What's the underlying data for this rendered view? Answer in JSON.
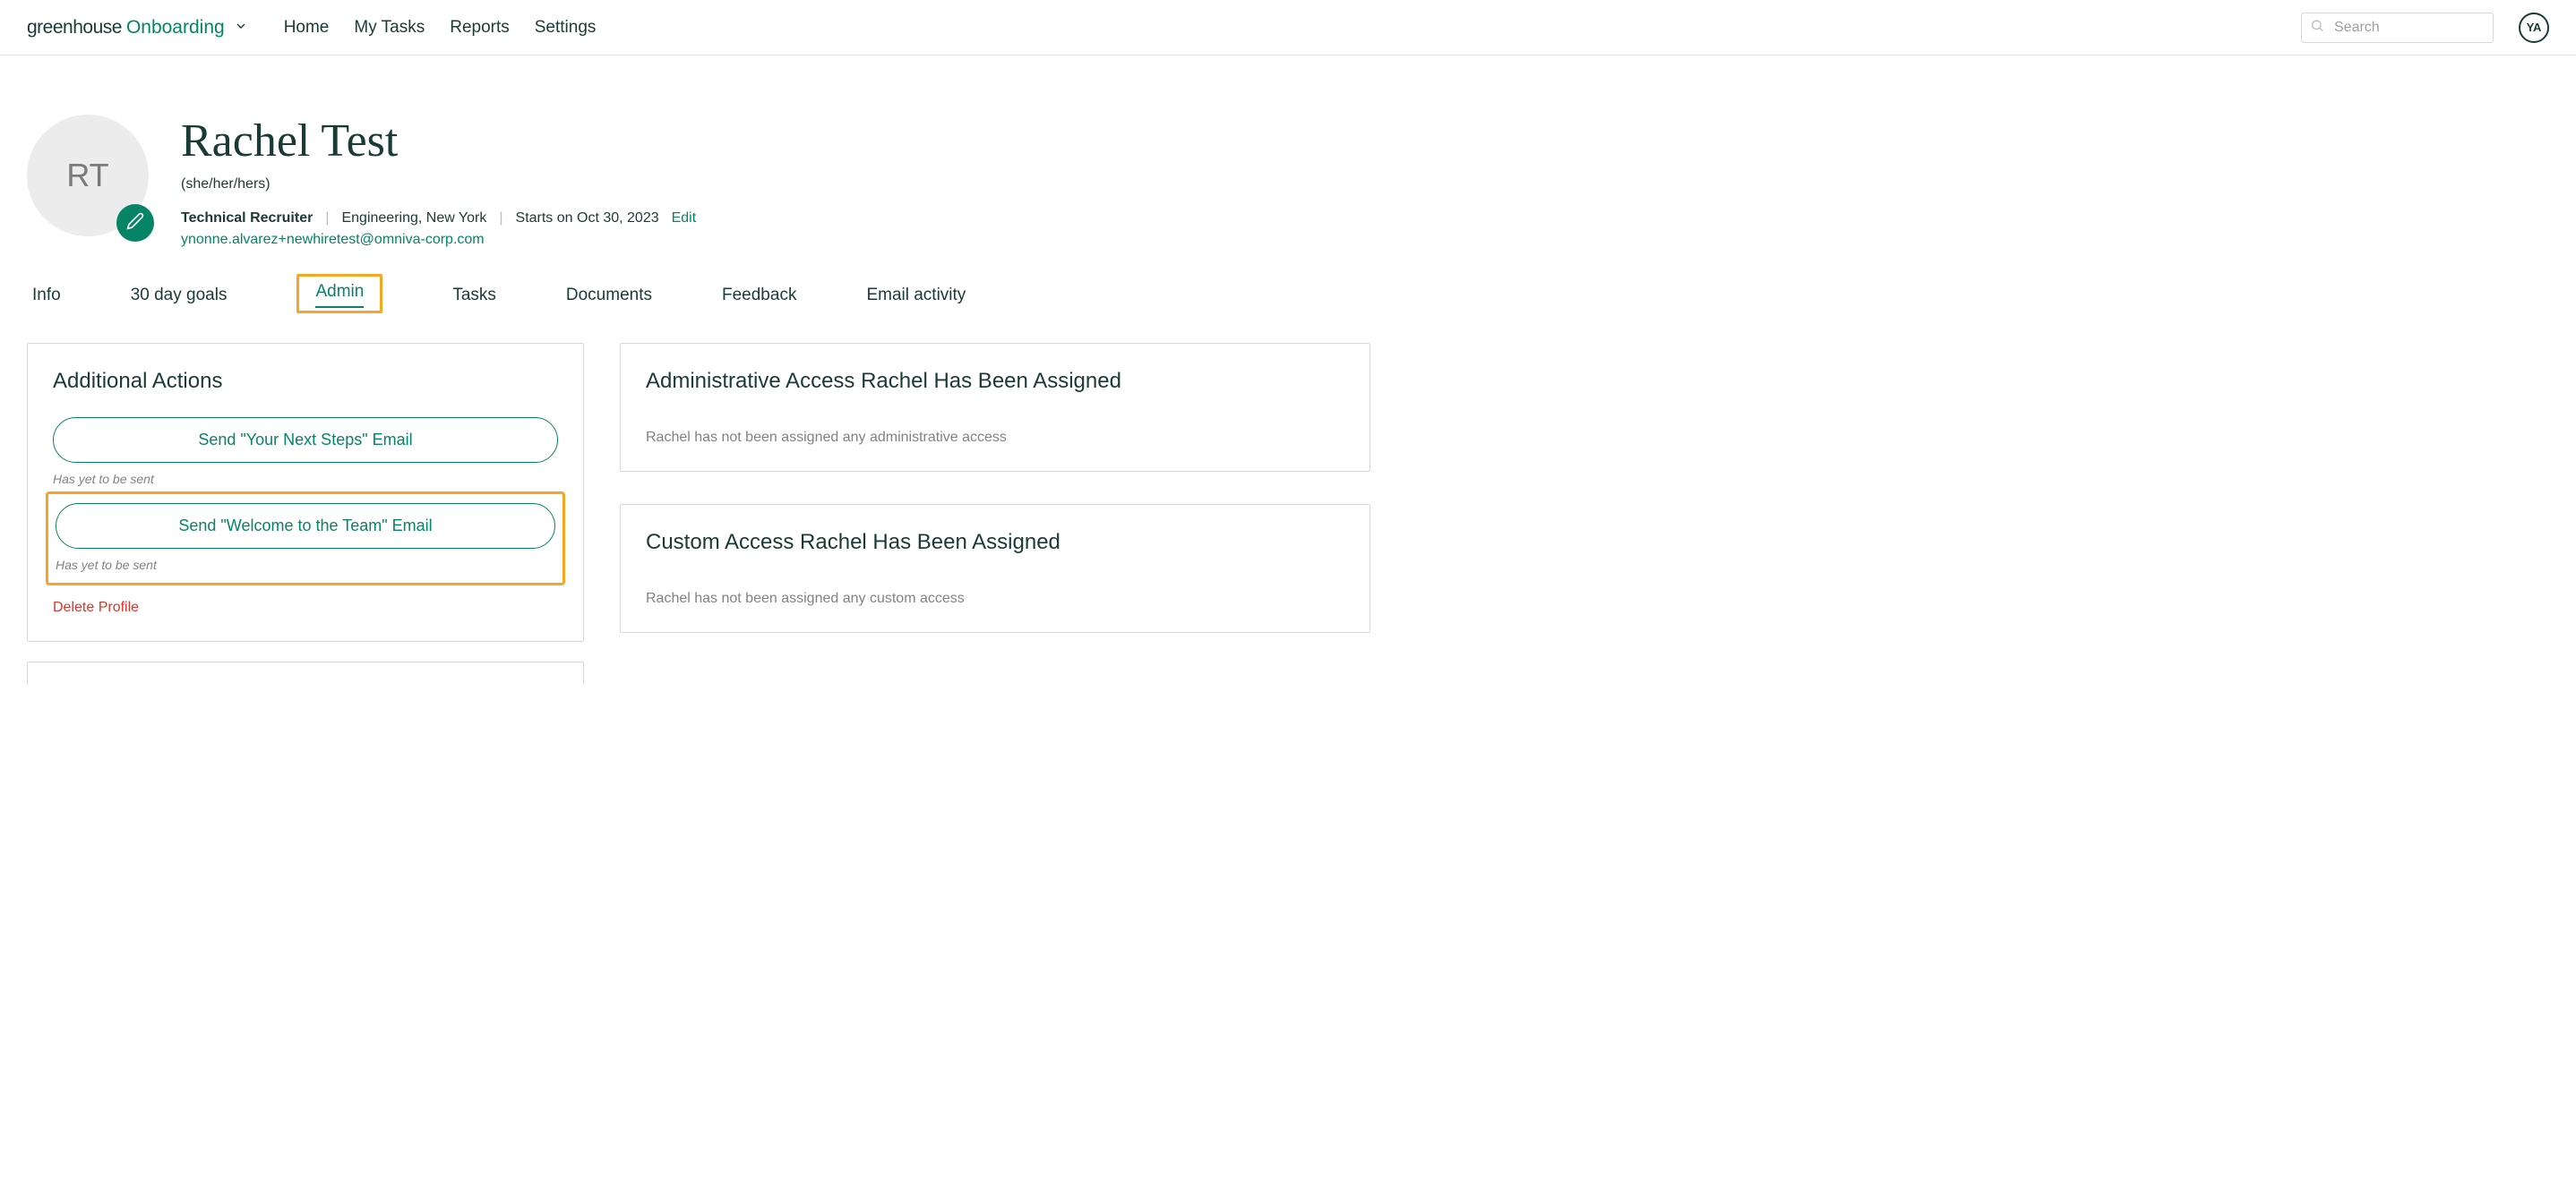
{
  "brand": {
    "name": "greenhouse",
    "product": "Onboarding"
  },
  "nav": {
    "items": [
      "Home",
      "My Tasks",
      "Reports",
      "Settings"
    ],
    "search_placeholder": "Search",
    "user_initials": "YA"
  },
  "profile": {
    "initials": "RT",
    "name": "Rachel Test",
    "pronouns": "(she/her/hers)",
    "title": "Technical Recruiter",
    "location": "Engineering, New York",
    "start": "Starts on Oct 30, 2023",
    "edit_label": "Edit",
    "email": "ynonne.alvarez+newhiretest@omniva-corp.com"
  },
  "tabs": {
    "items": [
      "Info",
      "30 day goals",
      "Admin",
      "Tasks",
      "Documents",
      "Feedback",
      "Email activity"
    ],
    "active_index": 2
  },
  "actions_panel": {
    "heading": "Additional Actions",
    "next_steps_btn": "Send \"Your Next Steps\" Email",
    "next_steps_status": "Has yet to be sent",
    "welcome_btn": "Send \"Welcome to the Team\" Email",
    "welcome_status": "Has yet to be sent",
    "delete_label": "Delete Profile"
  },
  "admin_access_panel": {
    "heading": "Administrative Access Rachel Has Been Assigned",
    "body": "Rachel has not been assigned any administrative access"
  },
  "custom_access_panel": {
    "heading": "Custom Access Rachel Has Been Assigned",
    "body": "Rachel has not been assigned any custom access"
  }
}
